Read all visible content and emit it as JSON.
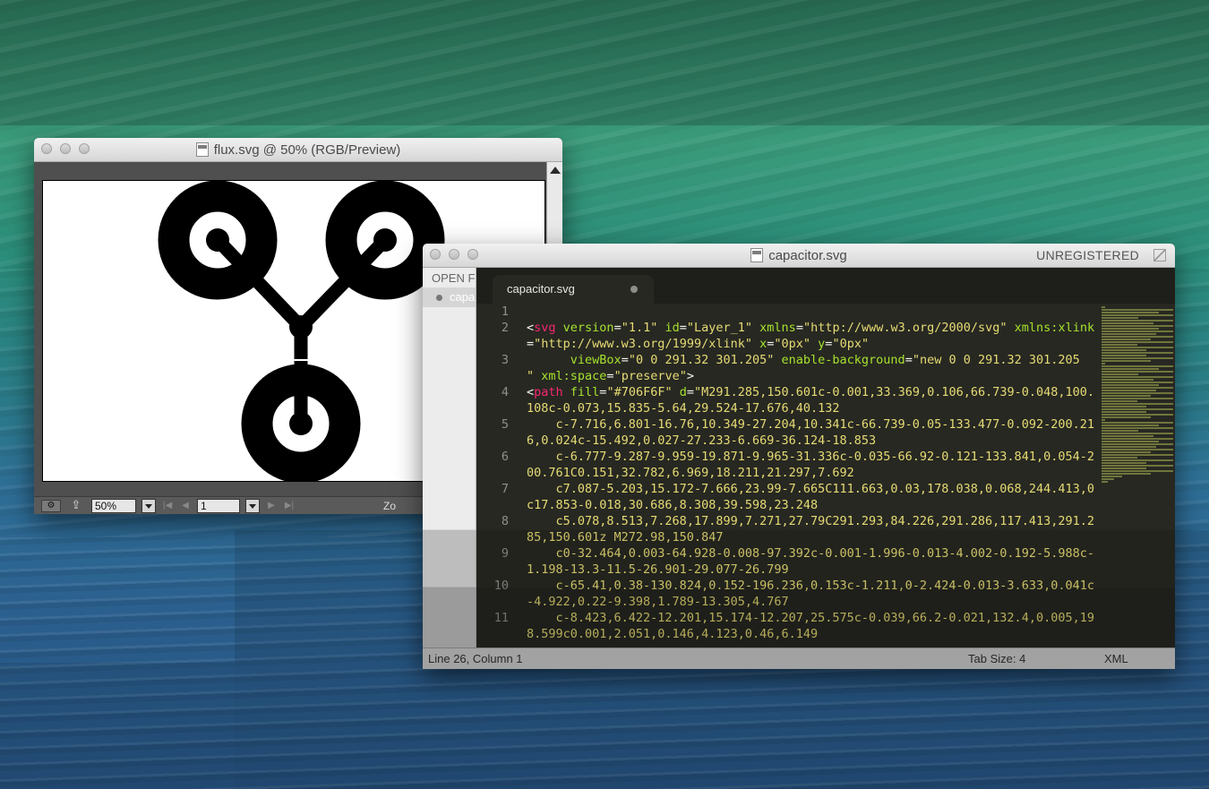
{
  "illustrator": {
    "title": "flux.svg @ 50% (RGB/Preview)",
    "zoom_value": "50%",
    "artboard_value": "1",
    "zoom_label_partial": "Zo"
  },
  "sublime": {
    "title": "capacitor.svg",
    "unregistered": "UNREGISTERED",
    "sidebar_header": "OPEN F",
    "sidebar_item": "capa",
    "tab_label": "capacitor.svg",
    "status_position": "Line 26, Column 1",
    "status_tab_size": "Tab Size: 4",
    "status_syntax": "XML",
    "lines": [
      {
        "n": "1",
        "parts": []
      },
      {
        "n": "2",
        "parts": [
          {
            "t": "<",
            "c": "punc"
          },
          {
            "t": "svg",
            "c": "tag"
          },
          {
            "t": " version",
            "c": "attr"
          },
          {
            "t": "=",
            "c": "punc"
          },
          {
            "t": "\"1.1\"",
            "c": "str"
          },
          {
            "t": " id",
            "c": "attr"
          },
          {
            "t": "=",
            "c": "punc"
          },
          {
            "t": "\"Layer_1\"",
            "c": "str"
          },
          {
            "t": " xmlns",
            "c": "attr"
          },
          {
            "t": "=",
            "c": "punc"
          },
          {
            "t": "\"http://www.w3.org/2000/svg\"",
            "c": "str"
          },
          {
            "t": " xmlns:",
            "c": "attr"
          },
          {
            "t": "​xlink",
            "c": "attr"
          },
          {
            "t": "=",
            "c": "punc"
          },
          {
            "t": "\"http://www.w3.org/1999/xlink\"",
            "c": "str"
          },
          {
            "t": " x",
            "c": "attr"
          },
          {
            "t": "=",
            "c": "punc"
          },
          {
            "t": "\"0px\"",
            "c": "str"
          },
          {
            "t": " y",
            "c": "attr"
          },
          {
            "t": "=",
            "c": "punc"
          },
          {
            "t": "\"0px\"",
            "c": "str"
          }
        ]
      },
      {
        "n": "3",
        "parts": [
          {
            "t": "      viewBox",
            "c": "attr"
          },
          {
            "t": "=",
            "c": "punc"
          },
          {
            "t": "\"0 0 291.32 301.205\"",
            "c": "str"
          },
          {
            "t": " enable-background",
            "c": "attr"
          },
          {
            "t": "=",
            "c": "punc"
          },
          {
            "t": "\"new 0 0 291.32 301.205",
            "c": "str"
          },
          {
            "t": "​      \"",
            "c": "str"
          },
          {
            "t": " xml:space",
            "c": "attr"
          },
          {
            "t": "=",
            "c": "punc"
          },
          {
            "t": "\"preserve\"",
            "c": "str"
          },
          {
            "t": ">",
            "c": "punc"
          }
        ]
      },
      {
        "n": "4",
        "parts": [
          {
            "t": "<",
            "c": "punc"
          },
          {
            "t": "path",
            "c": "tag"
          },
          {
            "t": " fill",
            "c": "attr"
          },
          {
            "t": "=",
            "c": "punc"
          },
          {
            "t": "\"#706F6F\"",
            "c": "str"
          },
          {
            "t": " d",
            "c": "attr"
          },
          {
            "t": "=",
            "c": "punc"
          },
          {
            "t": "\"M291.285,150.601c-0.001,33.369,0.106,66.739-0.048,100.108c-0.073,15.835-5.64,29.524-17.676,40.132",
            "c": "str"
          }
        ]
      },
      {
        "n": "5",
        "parts": [
          {
            "t": "    c-7.716,6.801-16.76,10.349-27.204,10.341c-66.739-0.05-133.477-0.092-200.216,0.024c-15.492,0.027-27.233-6.669-36.124-18.853",
            "c": "str"
          }
        ]
      },
      {
        "n": "6",
        "parts": [
          {
            "t": "    c-6.777-9.287-9.959-19.871-9.965-31.336c-0.035-66.92-0.121-133.841,0.054-200.761C0.151,32.782,6.969,18.211,21.297,7.692",
            "c": "str"
          }
        ]
      },
      {
        "n": "7",
        "parts": [
          {
            "t": "    c7.087-5.203,15.172-7.666,23.99-7.665C111.663,0.03,178.038,0.068,244.413,0c17.853-0.018,30.686,8.308,39.598,23.248",
            "c": "str"
          }
        ]
      },
      {
        "n": "8",
        "parts": [
          {
            "t": "    c5.078,8.513,7.268,17.899,7.271,27.79C291.293,84.226,291.286,117.413,291.285,150.601z M272.98,150.847",
            "c": "str"
          }
        ]
      },
      {
        "n": "9",
        "parts": [
          {
            "t": "    c0-32.464,0.003-64.928-0.008-97.392c-0.001-1.996-0.013-4.002-0.192-5.988c-1.198-13.3-11.5-26.901-29.077-26.799",
            "c": "str"
          }
        ]
      },
      {
        "n": "10",
        "parts": [
          {
            "t": "    c-65.41,0.38-130.824,0.152-196.236,0.153c-1.211,0-2.424-0.013-3.633,0.041c-4.922,0.22-9.398,1.789-13.305,4.767",
            "c": "str"
          }
        ]
      },
      {
        "n": "11",
        "parts": [
          {
            "t": "    c-8.423,6.422-12.201,15.174-12.207,25.575c-0.039,66.2-0.021,132.4,0.005,198.599c0.001,2.051,0.146,4.123,0.46,6.149",
            "c": "str"
          }
        ]
      }
    ]
  },
  "colors": {
    "editor_bg": "#272822",
    "tag": "#f92672",
    "attr": "#a6e22e",
    "string": "#e6db74"
  }
}
